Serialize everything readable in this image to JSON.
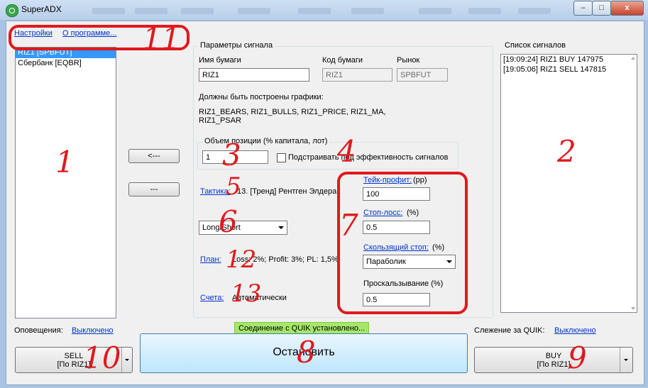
{
  "window": {
    "title": "SuperADX",
    "minimize_label": "–",
    "maximize_label": "□",
    "close_label": "x"
  },
  "menu": {
    "settings": "Настройки",
    "about": "О программе..."
  },
  "instruments": {
    "items": [
      {
        "label": "RIZ1 [SPBFUT]",
        "selected": true
      },
      {
        "label": "Сбербанк [EQBR]",
        "selected": false
      }
    ]
  },
  "middle_buttons": {
    "add": "<---",
    "remove": "---"
  },
  "signal_params": {
    "title": "Параметры сигнала",
    "security_name_label": "Имя бумаги",
    "security_name_value": "RIZ1",
    "security_code_label": "Код бумаги",
    "security_code_value": "RIZ1",
    "market_label": "Рынок",
    "market_value": "SPBFUT",
    "charts_required_label": "Должны быть построены графики:",
    "charts_line1": "RIZ1_BEARS, RIZ1_BULLS, RIZ1_PRICE, RIZ1_MA,",
    "charts_line2": "RIZ1_PSAR"
  },
  "position": {
    "group_label": "Объем позиции (% капитала, лот)",
    "value": "1",
    "adapt_label": "Подстраивать под эффективность сигналов"
  },
  "tactic": {
    "link": "Тактика:",
    "value": "13. [Тренд] Рентген Элдера",
    "direction_value": "Long/Short"
  },
  "plan": {
    "link": "План:",
    "value": "Loss: 2%; Profit: 3%; PL: 1,5%;"
  },
  "accounts": {
    "link": "Счета:",
    "value": "Автоматически"
  },
  "risk": {
    "take_profit_link": "Тейк-профит:",
    "take_profit_unit": "(pp)",
    "take_profit_value": "100",
    "stop_loss_link": "Стоп-лосс:",
    "stop_loss_unit": "(%)",
    "stop_loss_value": "0.5",
    "trailing_link": "Скользящий стоп:",
    "trailing_unit": "(%)",
    "trailing_value": "Параболик",
    "slippage_label": "Проскальзывание (%)",
    "slippage_value": "0.5"
  },
  "signals": {
    "title": "Список сигналов",
    "items": [
      "[19:09:24]  RIZ1  BUY  147975",
      "[19:05:06]  RIZ1  SELL  147815"
    ]
  },
  "bottom": {
    "alerts_label": "Оповещения:",
    "alerts_link": "Выключено",
    "connection_status": "Соединение с QUIK установлено...",
    "quik_watch_label": "Слежение за QUIK:",
    "quik_watch_link": "Выключено",
    "sell_label": "SELL",
    "sell_sub": "[По RIZ1]",
    "stop_label": "Остановить",
    "buy_label": "BUY",
    "buy_sub": "[По RIZ1]"
  },
  "annotations": {
    "n1": "1",
    "n2": "2",
    "n3": "3",
    "n4": "4",
    "n5": "5",
    "n6": "6",
    "n7": "7",
    "n8": "8",
    "n9": "9",
    "n10": "10",
    "n11": "11",
    "n12": "12",
    "n13": "13"
  },
  "colors": {
    "annotation": "#e0191d",
    "link": "#0033cc",
    "selection": "#3399ff",
    "status_ok": "#a6e76a"
  }
}
